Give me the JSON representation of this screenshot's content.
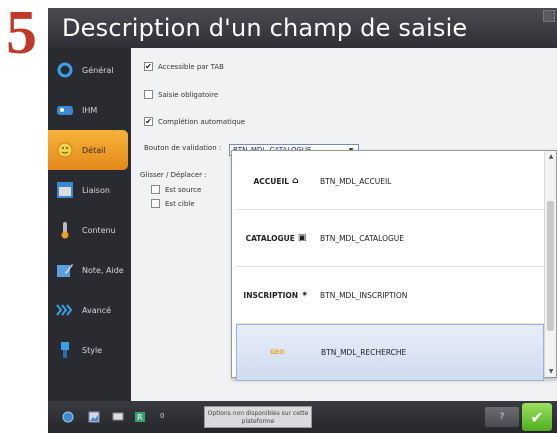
{
  "step": {
    "number": "5"
  },
  "window": {
    "title": "Description d'un champ de saisie"
  },
  "sidebar": {
    "items": [
      {
        "label": "Général",
        "icon": "circle-icon"
      },
      {
        "label": "IHM",
        "icon": "ihm-icon"
      },
      {
        "label": "Détail",
        "icon": "smiley-icon"
      },
      {
        "label": "Liaison",
        "icon": "window-icon"
      },
      {
        "label": "Contenu",
        "icon": "thermometer-icon"
      },
      {
        "label": "Note, Aide",
        "icon": "note-icon"
      },
      {
        "label": "Avancé",
        "icon": "chevrons-icon"
      },
      {
        "label": "Style",
        "icon": "brush-icon"
      }
    ],
    "active_index": 2
  },
  "content": {
    "accessible_tab": {
      "label": "Accessible par TAB",
      "checked": true
    },
    "saisie_obligatoire": {
      "label": "Saisie obligatoire",
      "checked": false
    },
    "completion_auto": {
      "label": "Complétion automatique",
      "checked": true
    },
    "bouton_validation": {
      "label": "Bouton de validation :",
      "value": "BTN_MDL_CATALOGUE"
    },
    "glisser": {
      "label": "Glisser / Déplacer :",
      "source": {
        "label": "Est source",
        "checked": false
      },
      "cible": {
        "label": "Est cible",
        "checked": false
      }
    }
  },
  "dropdown": {
    "options": [
      {
        "image_text": "ACCUEIL",
        "label": "BTN_MDL_ACCUEIL"
      },
      {
        "image_text": "CATALOGUE",
        "label": "BTN_MDL_CATALOGUE"
      },
      {
        "image_text": "INSCRIPTION",
        "label": "BTN_MDL_INSCRIPTION"
      },
      {
        "image_text": "GEO",
        "label": "BTN_MDL_RECHERCHE",
        "selected": true
      }
    ]
  },
  "bottombar": {
    "count": "0",
    "message": "Options non disponibles sur cette plateforme"
  },
  "colors": {
    "accent": "#e4891b",
    "window_bg": "#2a2b30",
    "content_bg": "#f1f2f4",
    "step_number": "#c0392b",
    "ok_green": "#4fae20"
  }
}
